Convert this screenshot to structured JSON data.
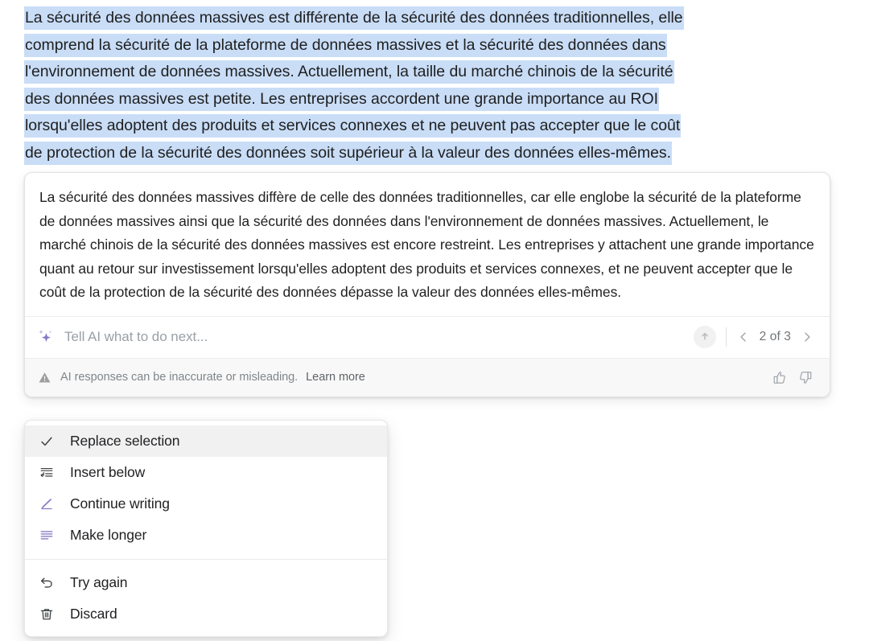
{
  "colors": {
    "selection_highlight": "#c9ddf7",
    "accent_purple": "#8a7cc8",
    "menu_hover": "#f1f1f1",
    "text_primary": "#1f1f1f",
    "text_muted": "#80868b"
  },
  "document": {
    "selected_lines": [
      "La sécurité des données massives est différente de la sécurité des données traditionnelles, elle",
      "comprend la sécurité de la plateforme de données massives et la sécurité des données dans",
      "l'environnement de données massives. Actuellement, la taille du marché chinois de la sécurité",
      "des données massives est petite. Les entreprises accordent une grande importance au ROI",
      "lorsqu'elles adoptent des produits et services connexes et ne peuvent pas accepter que le coût",
      "de protection de la sécurité des données soit supérieur à la valeur des données elles-mêmes."
    ]
  },
  "ai_card": {
    "response_text": "La sécurité des données massives diffère de celle des données traditionnelles, car elle englobe la sécurité de la plateforme de données massives ainsi que la sécurité des données dans l'environnement de données massives. Actuellement, le marché chinois de la sécurité des données massives est encore restreint. Les entreprises y attachent une grande importance quant au retour sur investissement lorsqu'elles adoptent des produits et services connexes, et ne peuvent accepter que le coût de la protection de la sécurité des données dépasse la valeur des données elles-mêmes.",
    "prompt": {
      "placeholder": "Tell AI what to do next...",
      "value": "",
      "sparkle_icon": "sparkle-icon",
      "send_icon": "arrow-up-circle-icon"
    },
    "pager": {
      "label": "2 of 3",
      "current": 2,
      "total": 3,
      "prev_icon": "chevron-left-icon",
      "next_icon": "chevron-right-icon"
    },
    "disclaimer": {
      "warning_icon": "warning-triangle-icon",
      "text": "AI responses can be inaccurate or misleading.",
      "learn_more": "Learn more",
      "thumbs_up_icon": "thumbs-up-icon",
      "thumbs_down_icon": "thumbs-down-icon"
    }
  },
  "menu": {
    "groups": [
      {
        "items": [
          {
            "label": "Replace selection",
            "icon": "check-icon",
            "selected": true
          },
          {
            "label": "Insert below",
            "icon": "insert-below-icon",
            "selected": false
          },
          {
            "label": "Continue writing",
            "icon": "pencil-icon",
            "selected": false
          },
          {
            "label": "Make longer",
            "icon": "make-longer-icon",
            "selected": false
          }
        ]
      },
      {
        "items": [
          {
            "label": "Try again",
            "icon": "undo-icon",
            "selected": false
          },
          {
            "label": "Discard",
            "icon": "trash-icon",
            "selected": false
          }
        ]
      }
    ]
  }
}
